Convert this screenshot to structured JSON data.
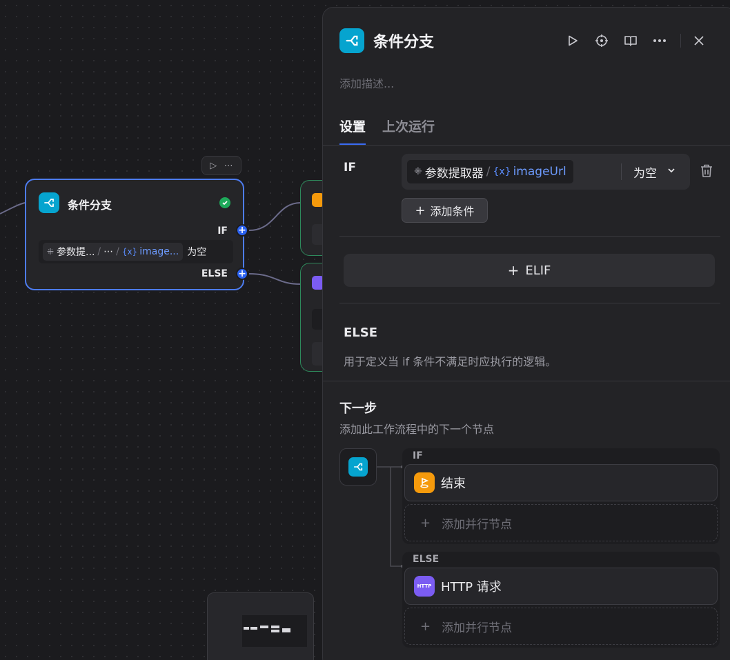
{
  "canvas": {
    "if_node": {
      "title": "条件分支",
      "label_if": "IF",
      "label_else": "ELSE",
      "condition": {
        "source": "参数提...",
        "separator": "/",
        "ellipsis": "⋯",
        "var_icon": "{x}",
        "variable": "image...",
        "operator": "为空"
      },
      "status": "success"
    },
    "toolbar": {
      "run_icon": "play-icon",
      "more_icon": "more-icon"
    }
  },
  "panel": {
    "title": "条件分支",
    "description_placeholder": "添加描述...",
    "tabs": [
      {
        "label": "设置",
        "active": true
      },
      {
        "label": "上次运行",
        "active": false
      }
    ],
    "if_section": {
      "label": "IF",
      "condition": {
        "source": "参数提取器",
        "separator": "/",
        "var_icon": "{x}",
        "variable": "imageUrl",
        "operator": "为空"
      },
      "add_condition": "添加条件"
    },
    "elif_button": "ELIF",
    "else_section": {
      "title": "ELSE",
      "description": "用于定义当 if 条件不满足时应执行的逻辑。"
    },
    "next_step": {
      "title": "下一步",
      "description": "添加此工作流程中的下一个节点",
      "branches": [
        {
          "label": "IF",
          "node": "结束",
          "add_parallel": "添加并行节点"
        },
        {
          "label": "ELSE",
          "node": "HTTP 请求",
          "node_badge": "HTTP",
          "add_parallel": "添加并行节点"
        }
      ]
    }
  },
  "colors": {
    "accent": "#2b62f0",
    "if_icon": "#06a4cf",
    "end_icon": "#f59a0c",
    "http_icon": "#7b5cf2",
    "success": "#1eaa5a"
  }
}
